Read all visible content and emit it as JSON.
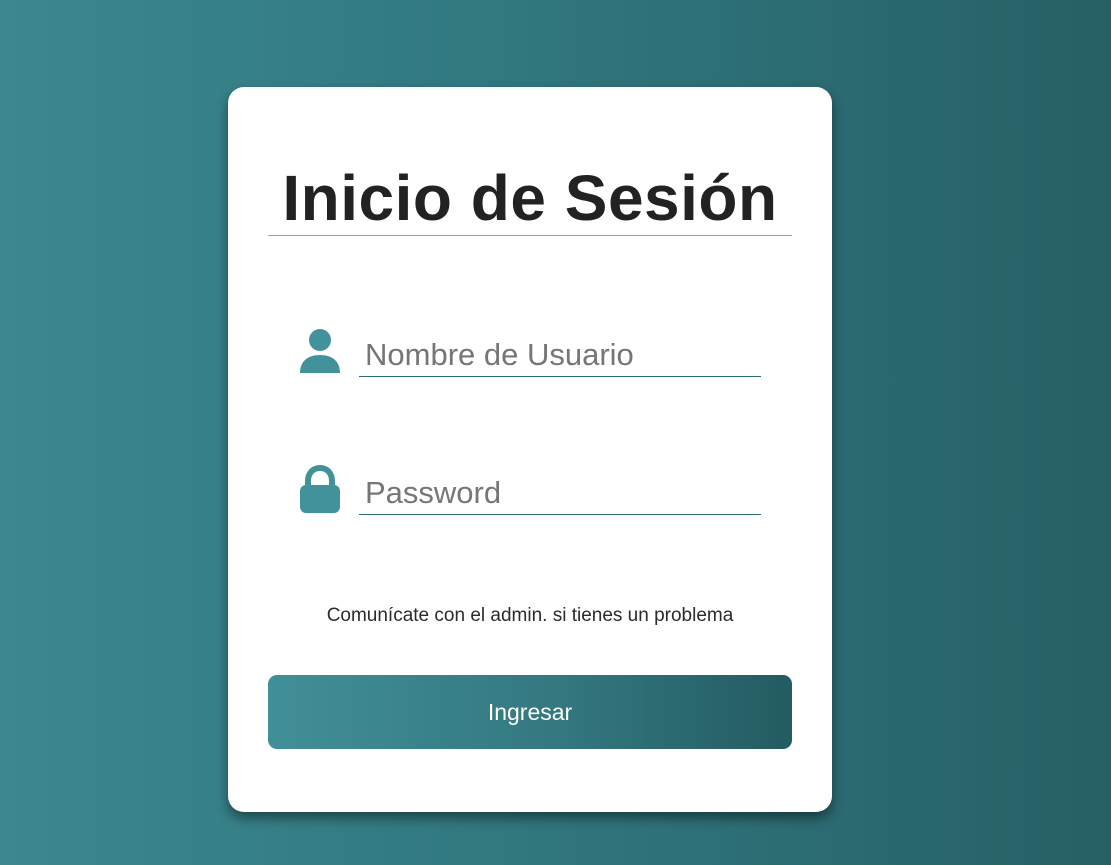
{
  "login": {
    "title": "Inicio de Sesión",
    "username": {
      "icon": "user-icon",
      "placeholder": "Nombre de Usuario",
      "value": ""
    },
    "password": {
      "icon": "lock-icon",
      "placeholder": "Password",
      "value": ""
    },
    "help_text": "Comunícate con el admin. si tienes un problema",
    "submit_label": "Ingresar"
  },
  "colors": {
    "accent": "#42929b",
    "background_start": "#3b8890",
    "background_end": "#275f66",
    "card": "#ffffff",
    "title_text": "#222222"
  }
}
